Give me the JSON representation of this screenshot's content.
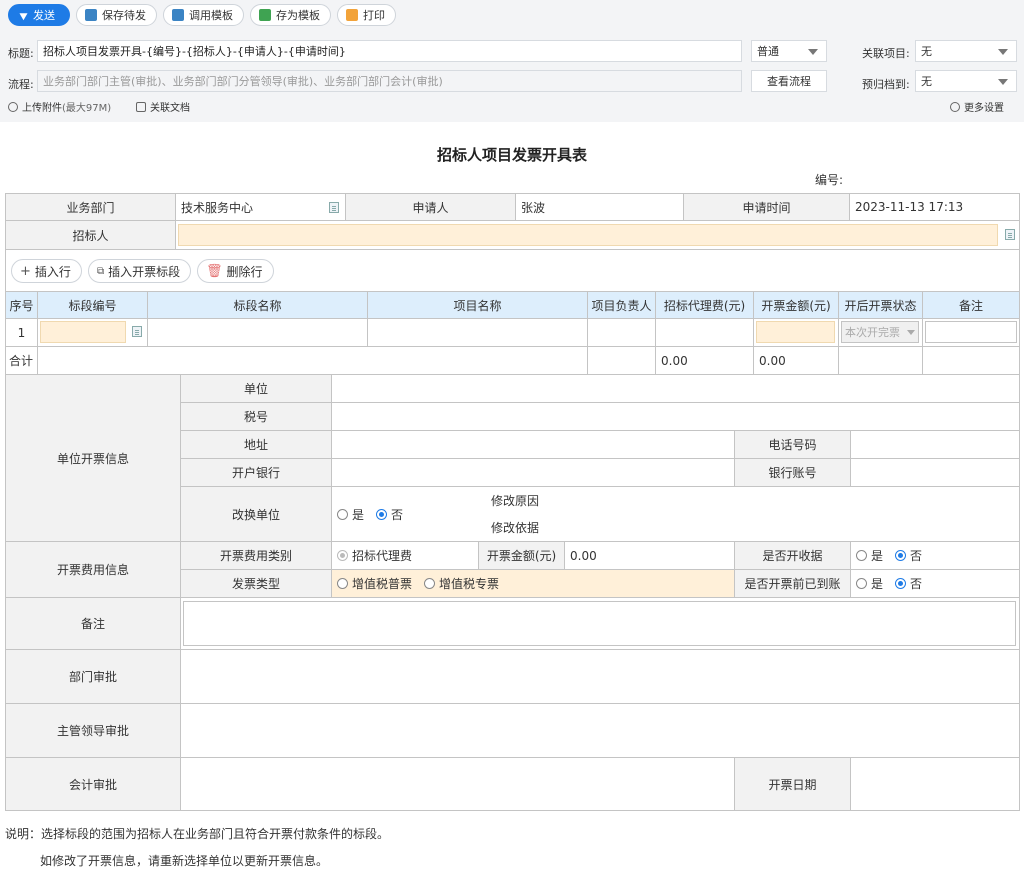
{
  "toolbar": {
    "send": "发送",
    "save_pending": "保存待发",
    "use_template": "调用模板",
    "save_as_template": "存为模板",
    "print": "打印"
  },
  "header": {
    "title_label": "标题:",
    "title_value": "招标人项目发票开具-{编号}-{招标人}-{申请人}-{申请时间}",
    "priority_value": "普通",
    "related_project_label": "关联项目:",
    "related_project_value": "无",
    "flow_label": "流程:",
    "flow_value": "业务部门部门主管(审批)、业务部门部门分管领导(审批)、业务部门部门会计(审批)",
    "view_flow": "查看流程",
    "archive_label": "预归档到:",
    "archive_value": "无",
    "upload": "上传附件",
    "upload_limit": "(最大97M)",
    "related_doc": "关联文档",
    "more_settings": "更多设置"
  },
  "form": {
    "title": "招标人项目发票开具表",
    "number_label": "编号:",
    "dept_label": "业务部门",
    "dept_value": "技术服务中心",
    "applicant_label": "申请人",
    "applicant_value": "张波",
    "apply_time_label": "申请时间",
    "apply_time_value": "2023-11-13 17:13",
    "tenderer_label": "招标人",
    "insert_row": "插入行",
    "insert_section": "插入开票标段",
    "delete_row": "删除行",
    "columns": [
      "序号",
      "标段编号",
      "标段名称",
      "项目名称",
      "项目负责人",
      "招标代理费(元)",
      "开票金额(元)",
      "开后开票状态",
      "备注"
    ],
    "row1_index": "1",
    "row1_status": "本次开完票",
    "total_label": "合计",
    "total_agency_fee": "0.00",
    "total_invoice_amount": "0.00",
    "unit_info_label": "单位开票信息",
    "unit_label": "单位",
    "tax_no_label": "税号",
    "address_label": "地址",
    "phone_label": "电话号码",
    "bank_label": "开户银行",
    "account_label": "银行账号",
    "change_unit_label": "改换单位",
    "yes": "是",
    "no": "否",
    "modify_reason_label": "修改原因",
    "modify_basis_label": "修改依据",
    "fee_info_label": "开票费用信息",
    "fee_type_label": "开票费用类别",
    "fee_type_value": "招标代理费",
    "invoice_amount_label": "开票金额(元)",
    "invoice_amount_value": "0.00",
    "receipt_label": "是否开收据",
    "invoice_type_label": "发票类型",
    "vat_normal": "增值税普票",
    "vat_special": "增值税专票",
    "paid_label": "是否开票前已到账",
    "remark_label": "备注",
    "dept_approval": "部门审批",
    "leader_approval": "主管领导审批",
    "account_approval": "会计审批",
    "invoice_date_label": "开票日期"
  },
  "notes": {
    "line1": "说明：选择标段的范围为招标人在业务部门且符合开票付款条件的标段。",
    "line2": "如修改了开票信息，请重新选择单位以更新开票信息。"
  }
}
